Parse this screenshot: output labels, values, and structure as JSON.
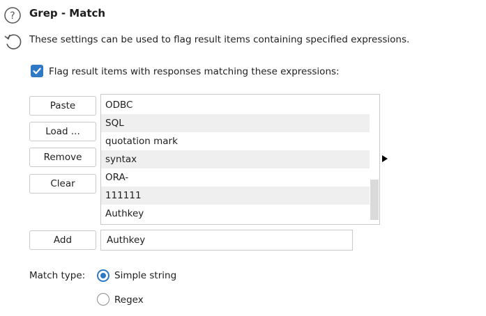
{
  "section": {
    "title": "Grep - Match",
    "description": "These settings can be used to flag result items containing specified expressions."
  },
  "flag_checkbox": {
    "label": "Flag result items with responses matching these expressions:",
    "checked": true
  },
  "buttons": {
    "paste": "Paste",
    "load": "Load ...",
    "remove": "Remove",
    "clear": "Clear",
    "add": "Add"
  },
  "expressions": [
    "ODBC",
    "SQL",
    "quotation mark",
    "syntax",
    "ORA-",
    "111111",
    "Authkey"
  ],
  "add_input": {
    "value": "Authkey"
  },
  "match_type": {
    "label": "Match type:",
    "options": [
      "Simple string",
      "Regex"
    ],
    "selected": "Simple string"
  },
  "colors": {
    "accent": "#2e78c4",
    "alt_row": "#efefef",
    "border": "#c9c9c9"
  }
}
